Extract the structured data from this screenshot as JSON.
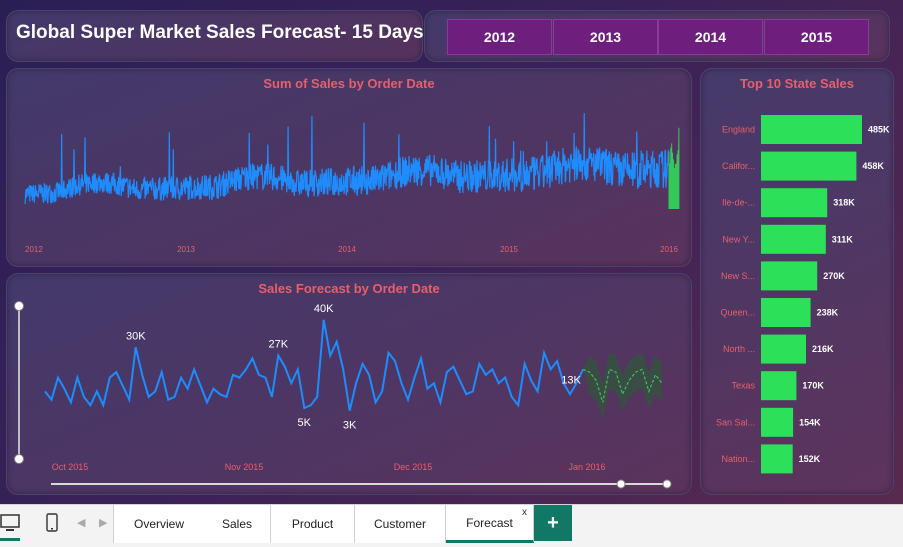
{
  "header": {
    "title": "Global Super Market Sales Forecast- 15 Days"
  },
  "year_slicer": [
    "2012",
    "2013",
    "2014",
    "2015"
  ],
  "colors": {
    "line": "#1e8cff",
    "forecast": "#2f6b3e",
    "bar": "#2de05a",
    "title": "#e85f6a",
    "accent": "#6e1f7e"
  },
  "tabs": {
    "items": [
      "Overview",
      "Sales",
      "Product",
      "Customer",
      "Forecast"
    ],
    "active": "Forecast",
    "add_label": "+",
    "close_label": "x"
  },
  "chart_data": [
    {
      "type": "line",
      "title": "Sum of Sales by Order Date",
      "x_ticks": [
        "2012",
        "2013",
        "2014",
        "2015",
        "2016"
      ],
      "series": [
        {
          "values": []
        }
      ]
    },
    {
      "type": "line",
      "title": "Sales Forecast by Order Date",
      "x_ticks": [
        "Oct 2015",
        "Nov 2015",
        "Dec 2015",
        "Jan 2016"
      ],
      "series": [
        {
          "values": [
            14,
            11,
            19,
            15,
            10,
            19,
            12,
            9,
            14,
            9,
            19,
            21,
            16,
            11,
            30,
            20,
            12,
            14,
            21,
            11,
            12,
            19,
            15,
            22,
            16,
            10,
            15,
            13,
            12,
            20,
            19,
            22,
            26,
            20,
            19,
            12,
            27,
            23,
            17,
            22,
            8,
            9,
            12,
            40,
            27,
            32,
            22,
            7,
            17,
            24,
            20,
            10,
            14,
            28,
            25,
            17,
            11,
            19,
            26,
            15,
            17,
            10,
            21,
            23,
            18,
            13,
            14,
            24,
            20,
            22,
            17,
            19,
            12,
            9,
            24,
            18,
            14,
            28,
            22,
            25,
            17,
            13,
            17,
            22
          ]
        }
      ],
      "forecast": {
        "values": [
          21,
          18,
          10,
          22,
          21,
          13,
          18,
          21,
          22,
          14,
          20,
          17
        ],
        "lower": [
          13,
          11,
          4,
          15,
          14,
          7,
          12,
          14,
          15,
          8,
          13,
          10
        ],
        "upper": [
          27,
          25,
          17,
          28,
          27,
          20,
          25,
          27,
          28,
          21,
          27,
          24
        ]
      },
      "data_labels": [
        {
          "index": 14,
          "text": "30K"
        },
        {
          "index": 36,
          "text": "27K"
        },
        {
          "index": 43,
          "text": "40K"
        },
        {
          "index": 40,
          "text": "5K"
        },
        {
          "index": 47,
          "text": "3K"
        },
        {
          "index": 83,
          "text": "13K"
        }
      ],
      "ylim": [
        0,
        45
      ]
    },
    {
      "type": "bar",
      "title": "Top 10 State Sales",
      "categories": [
        "England",
        "Califor...",
        "Ile-de-...",
        "New Y...",
        "New S...",
        "Queen...",
        "North ...",
        "Texas",
        "San Sal...",
        "Nation..."
      ],
      "values": [
        485,
        458,
        318,
        311,
        270,
        238,
        216,
        170,
        154,
        152
      ],
      "value_labels": [
        "485K",
        "458K",
        "318K",
        "311K",
        "270K",
        "238K",
        "216K",
        "170K",
        "154K",
        "152K"
      ]
    }
  ]
}
